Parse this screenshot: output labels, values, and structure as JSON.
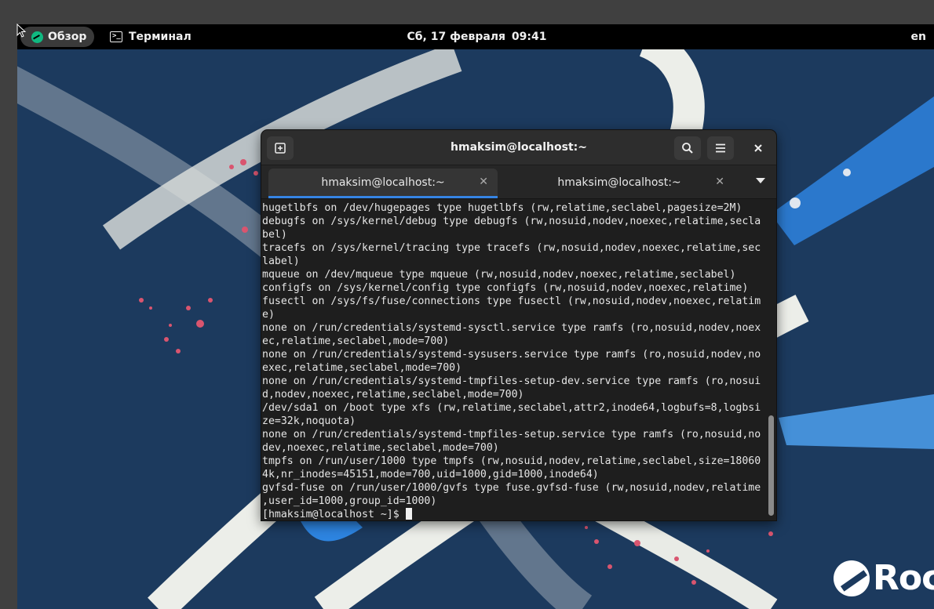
{
  "topbar": {
    "overview_label": "Обзор",
    "app_label": "Терминал",
    "date": "Сб, 17 февраля",
    "time": "09:41",
    "lang": "en"
  },
  "window": {
    "title": "hmaksim@localhost:~",
    "tabs": [
      {
        "label": "hmaksim@localhost:~",
        "active": true
      },
      {
        "label": "hmaksim@localhost:~",
        "active": false
      }
    ]
  },
  "terminal": {
    "lines": [
      "hugetlbfs on /dev/hugepages type hugetlbfs (rw,relatime,seclabel,pagesize=2M)",
      "debugfs on /sys/kernel/debug type debugfs (rw,nosuid,nodev,noexec,relatime,secla",
      "bel)",
      "tracefs on /sys/kernel/tracing type tracefs (rw,nosuid,nodev,noexec,relatime,sec",
      "label)",
      "mqueue on /dev/mqueue type mqueue (rw,nosuid,nodev,noexec,relatime,seclabel)",
      "configfs on /sys/kernel/config type configfs (rw,nosuid,nodev,noexec,relatime)",
      "fusectl on /sys/fs/fuse/connections type fusectl (rw,nosuid,nodev,noexec,relatim",
      "e)",
      "none on /run/credentials/systemd-sysctl.service type ramfs (ro,nosuid,nodev,noex",
      "ec,relatime,seclabel,mode=700)",
      "none on /run/credentials/systemd-sysusers.service type ramfs (ro,nosuid,nodev,no",
      "exec,relatime,seclabel,mode=700)",
      "none on /run/credentials/systemd-tmpfiles-setup-dev.service type ramfs (ro,nosui",
      "d,nodev,noexec,relatime,seclabel,mode=700)",
      "/dev/sda1 on /boot type xfs (rw,relatime,seclabel,attr2,inode64,logbufs=8,logbsi",
      "ze=32k,noquota)",
      "none on /run/credentials/systemd-tmpfiles-setup.service type ramfs (ro,nosuid,no",
      "dev,noexec,relatime,seclabel,mode=700)",
      "tmpfs on /run/user/1000 type tmpfs (rw,nosuid,nodev,relatime,seclabel,size=18060",
      "4k,nr_inodes=45151,mode=700,uid=1000,gid=1000,inode64)",
      "gvfsd-fuse on /run/user/1000/gvfs type fuse.gvfsd-fuse (rw,nosuid,nodev,relatime",
      ",user_id=1000,group_id=1000)"
    ],
    "prompt": "[hmaksim@localhost ~]$ "
  },
  "desktop": {
    "logo_text": "Roc"
  },
  "colors": {
    "desktop_bg": "#1c3a5e",
    "accent": "#3584e4",
    "rocky_green": "#10b981"
  }
}
